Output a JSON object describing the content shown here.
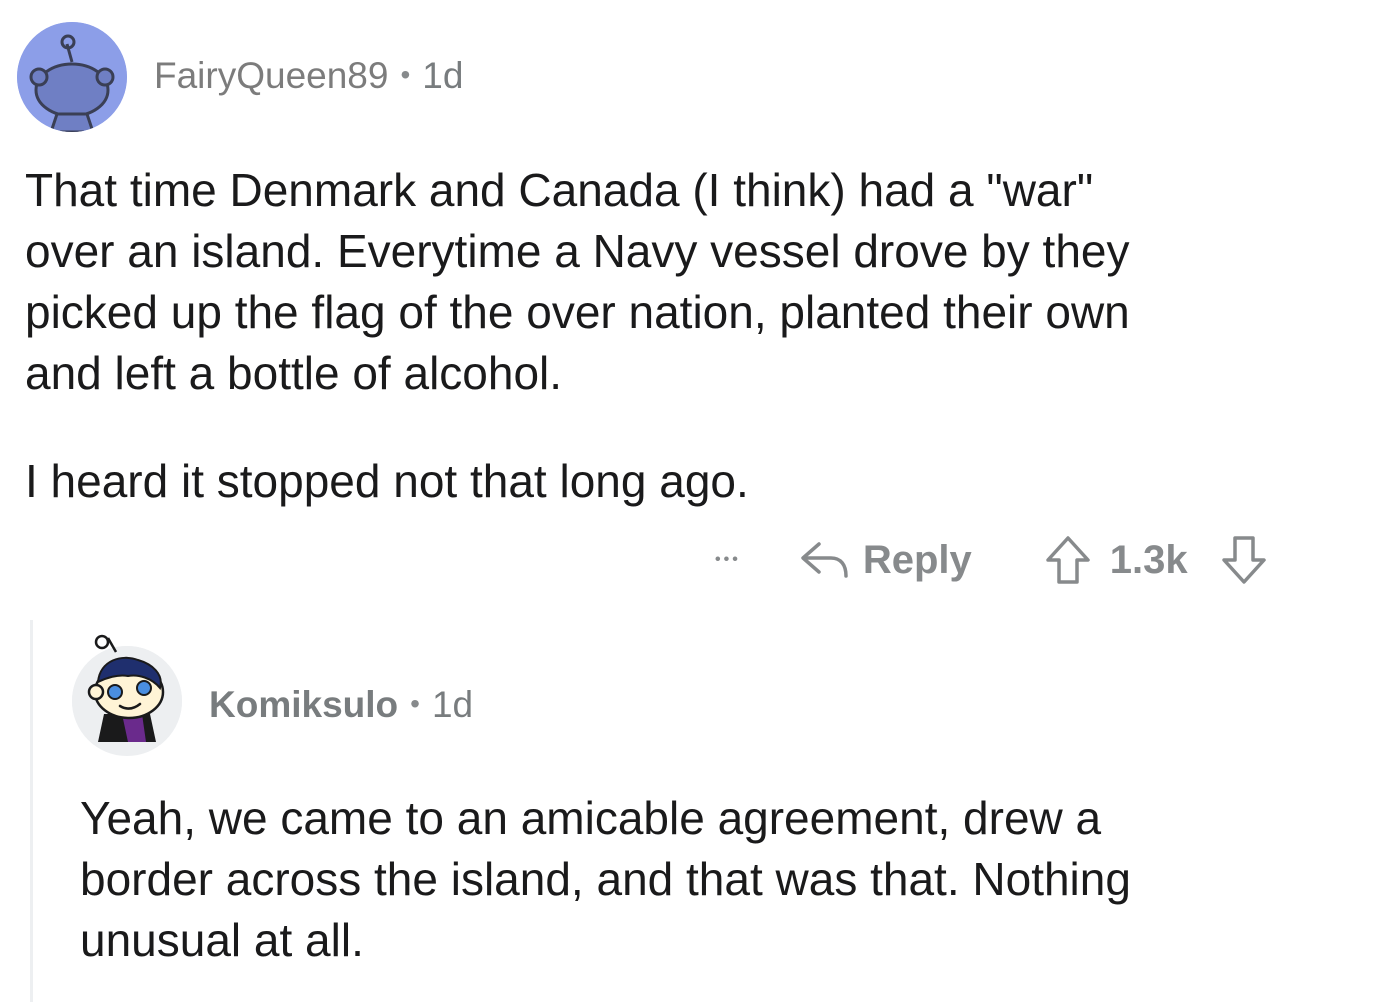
{
  "parent": {
    "username": "FairyQueen89",
    "separator": "•",
    "age": "1d",
    "lines": [
      "That time Denmark and Canada (I think) had a \"war\"",
      "over an island. Everytime a Navy vessel drove by they",
      "picked up the flag of the over nation, planted their own",
      "and left a bottle of alcohol."
    ],
    "paragraph2": "I heard it stopped not that long ago.",
    "actions": {
      "more": "•••",
      "reply_label": "Reply",
      "score": "1.3k"
    }
  },
  "reply": {
    "username": "Komiksulo",
    "separator": "•",
    "age": "1d",
    "lines": [
      "Yeah, we came to an amicable agreement, drew a",
      "border across the island, and that was that. Nothing",
      "unusual at all."
    ]
  },
  "colors": {
    "avatar1_bg": "#8c9ee8",
    "meta_gray": "#787c7e",
    "icon_gray": "#878a8c",
    "thread_line": "#edeff1"
  },
  "icons": [
    "snoo-avatar-icon",
    "custom-snoo-avatar-icon",
    "more-options-icon",
    "reply-arrow-icon",
    "upvote-icon",
    "downvote-icon"
  ]
}
